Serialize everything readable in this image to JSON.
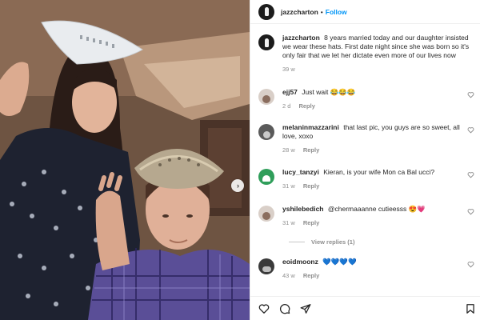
{
  "post": {
    "author": "jazzcharton",
    "separator": "•",
    "follow_label": "Follow",
    "caption": "8 years married today and our daughter insisted we wear these hats. First date night since she was born so it's only fair that we let her dictate even more of our lives now",
    "caption_time": "39 w"
  },
  "carousel": {
    "next_icon": "chevron-right-icon",
    "next_glyph": "›"
  },
  "comments": [
    {
      "user": "ejj57",
      "text": "Just wait 😂😂😂",
      "time": "2 d",
      "reply_label": "Reply"
    },
    {
      "user": "melaninmazzarini",
      "text": "that last pic, you guys are so sweet, all love, xoxo",
      "time": "28 w",
      "reply_label": "Reply"
    },
    {
      "user": "lucy_tanzyi",
      "text": "Kieran, is your wife Mon ca Bal ucci?",
      "time": "31 w",
      "reply_label": "Reply"
    },
    {
      "user": "yshilebedich",
      "text": "@chermaaanne cutieesss 😍💗",
      "time": "31 w",
      "reply_label": "Reply"
    },
    {
      "user": "eoidmoonz",
      "text": "💙💙💙💙",
      "time": "43 w",
      "reply_label": "Reply"
    }
  ],
  "view_replies_label": "View replies (1)",
  "colors": {
    "link_blue": "#0095f6",
    "muted_gray": "#8e8e8e",
    "text": "#262626",
    "border": "#efefef"
  },
  "actions": {
    "icons": [
      "heart-icon",
      "comment-icon",
      "share-icon",
      "bookmark-icon"
    ]
  }
}
